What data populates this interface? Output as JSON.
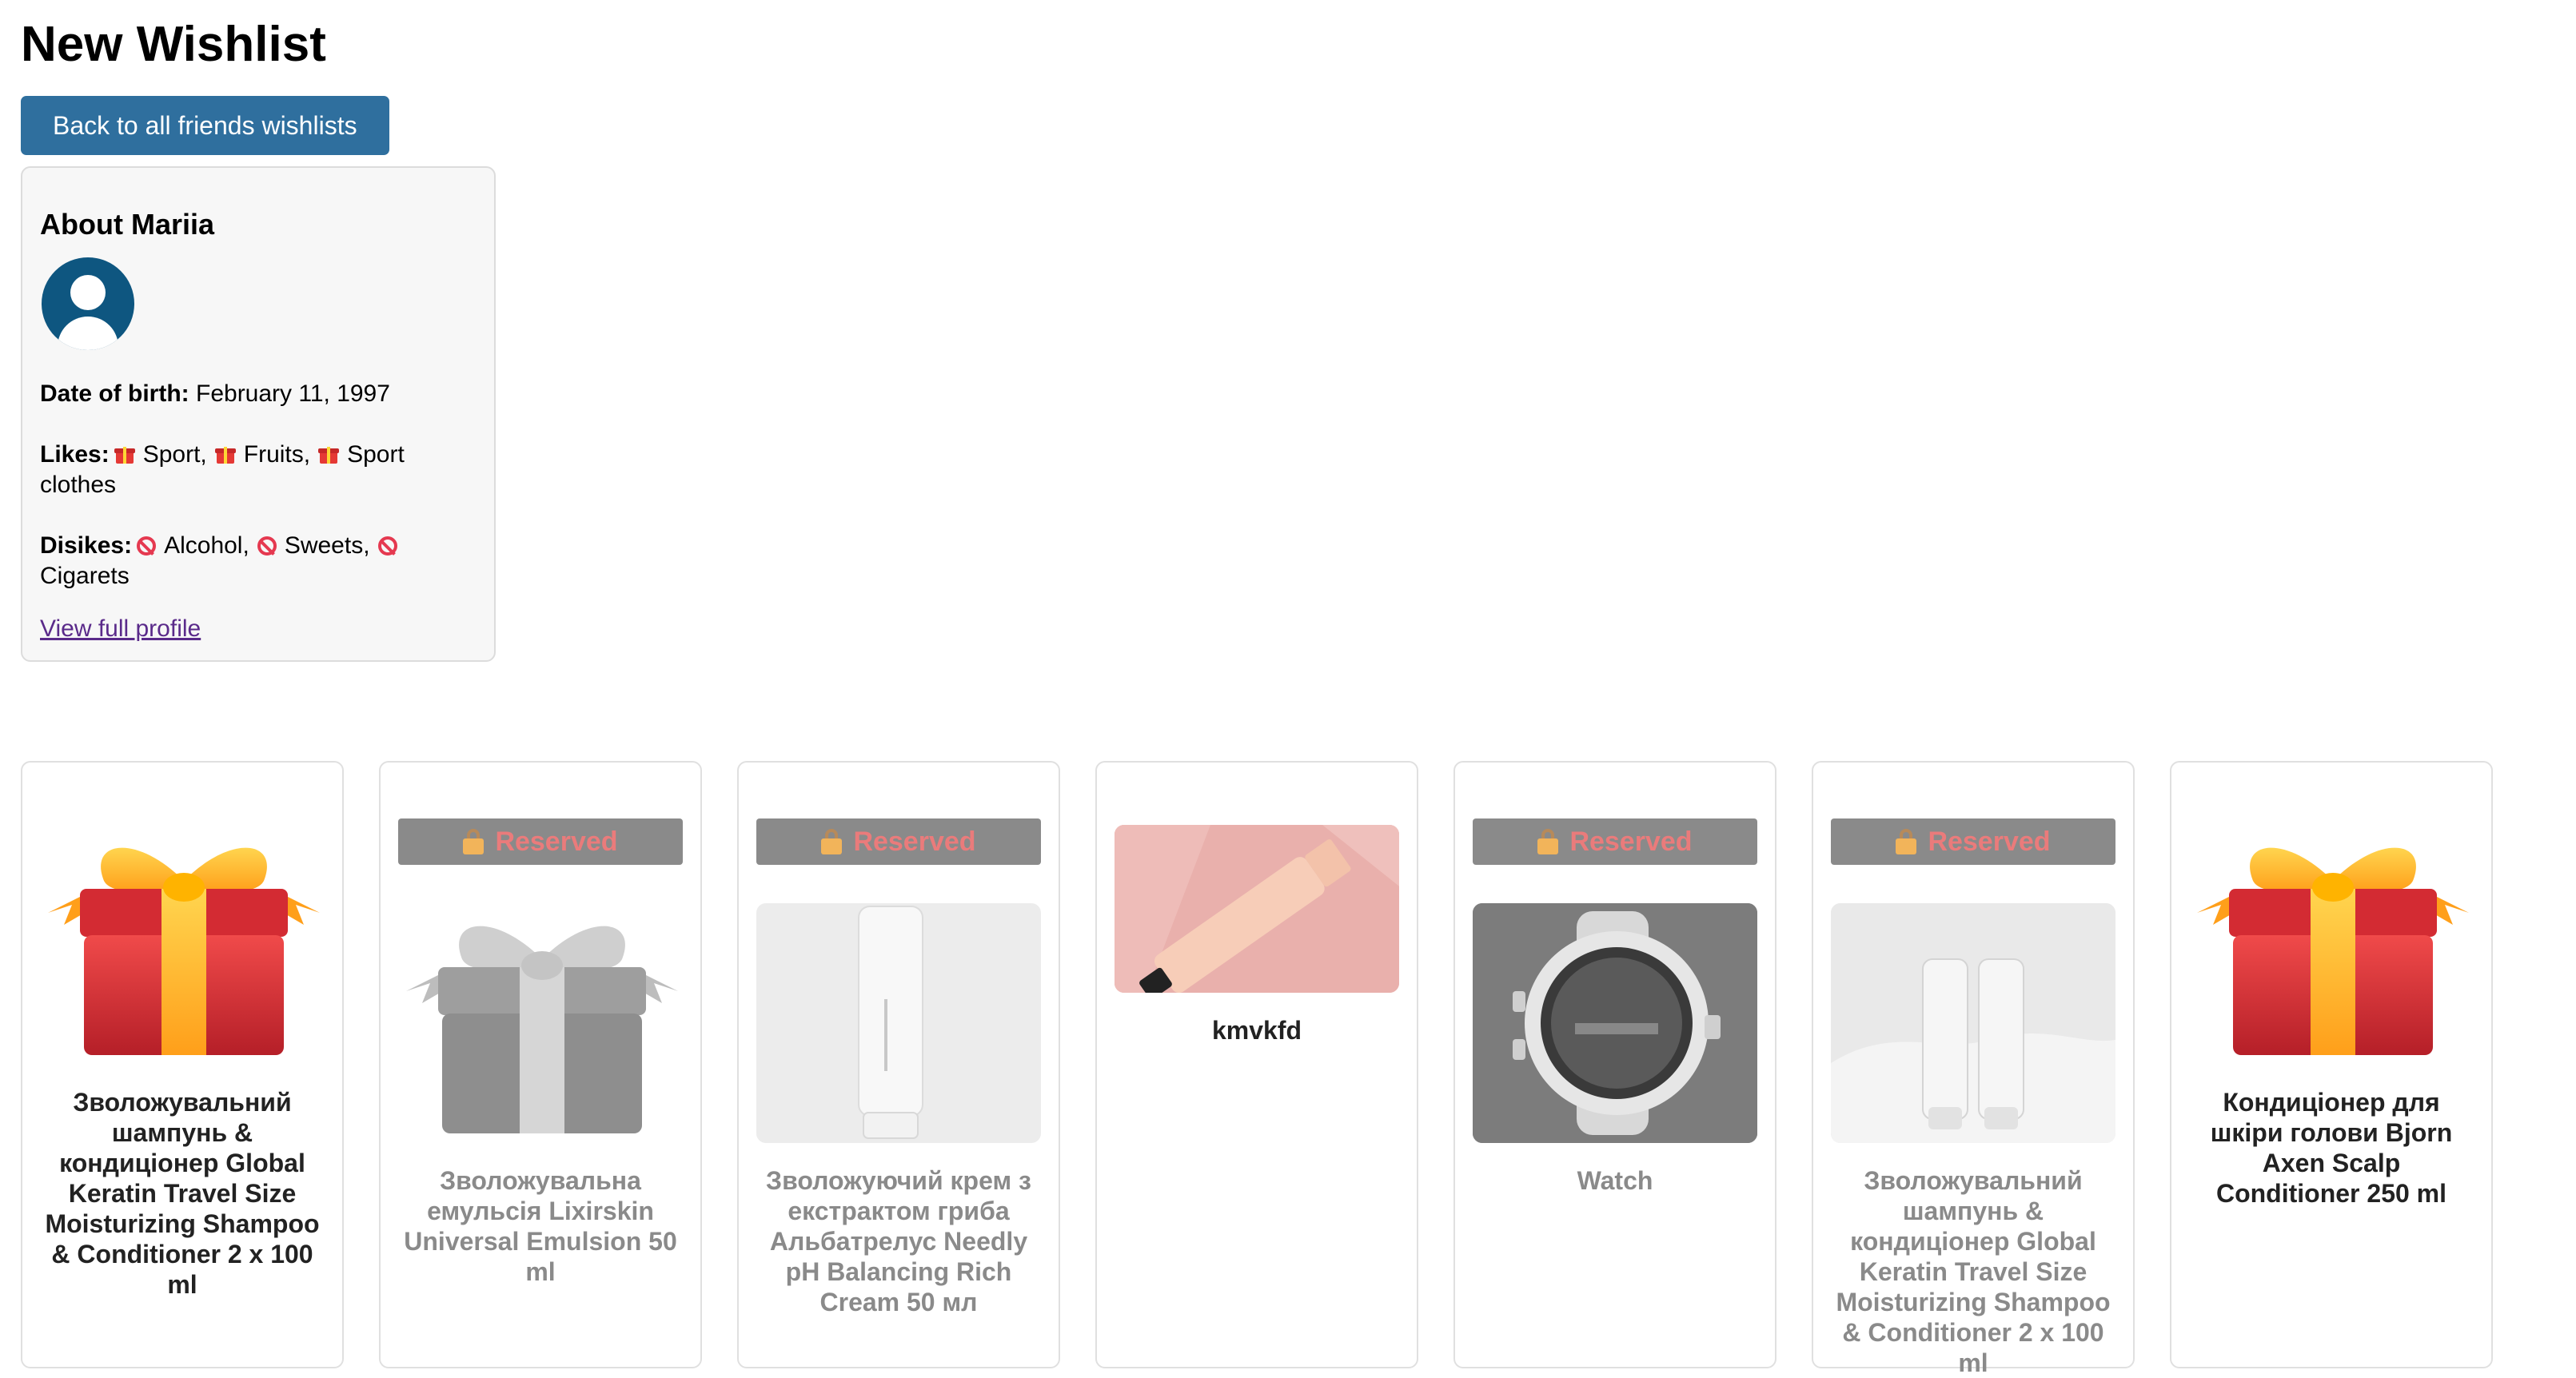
{
  "page": {
    "title": "New Wishlist"
  },
  "nav": {
    "back_label": "Back to all friends wishlists"
  },
  "about": {
    "heading": "About Mariia",
    "dob_label": "Date of birth:",
    "dob_value": "February 11, 1997",
    "likes_label": "Likes:",
    "likes": [
      "Sport,",
      "Fruits,",
      "Sport clothes"
    ],
    "dislikes_label": "Disikes:",
    "dislikes": [
      "Alcohol,",
      "Sweets,",
      "Cigarets"
    ],
    "profile_link": "View full profile"
  },
  "reserved_label": "Reserved",
  "items": [
    {
      "name": "Зволожувальний шампунь & кондиціонер Global Keratin Travel Size Moisturizing Shampoo & Conditioner 2 x 100 ml",
      "reserved": false,
      "image": "gift-color"
    },
    {
      "name": "Зволожувальна емульсія Lixirskin Universal Emulsion 50 ml",
      "reserved": true,
      "image": "gift-gray"
    },
    {
      "name": "Зволожуючий крем з екстрактом гриба Альбатрелус Needly pH Balancing Rich Cream 50 мл",
      "reserved": true,
      "image": "cream-tube"
    },
    {
      "name": "kmvkfd",
      "reserved": false,
      "image": "emulsion-photo"
    },
    {
      "name": "Watch",
      "reserved": true,
      "image": "smartwatch"
    },
    {
      "name": "Зволожувальний шампунь & кондиціонер Global Keratin Travel Size Moisturizing Shampoo & Conditioner 2 x 100 ml",
      "reserved": true,
      "image": "shampoo-bottles"
    },
    {
      "name": "Кондиціонер для шкіри голови Bjorn Axen Scalp Conditioner 250 ml",
      "reserved": false,
      "image": "gift-color"
    }
  ]
}
